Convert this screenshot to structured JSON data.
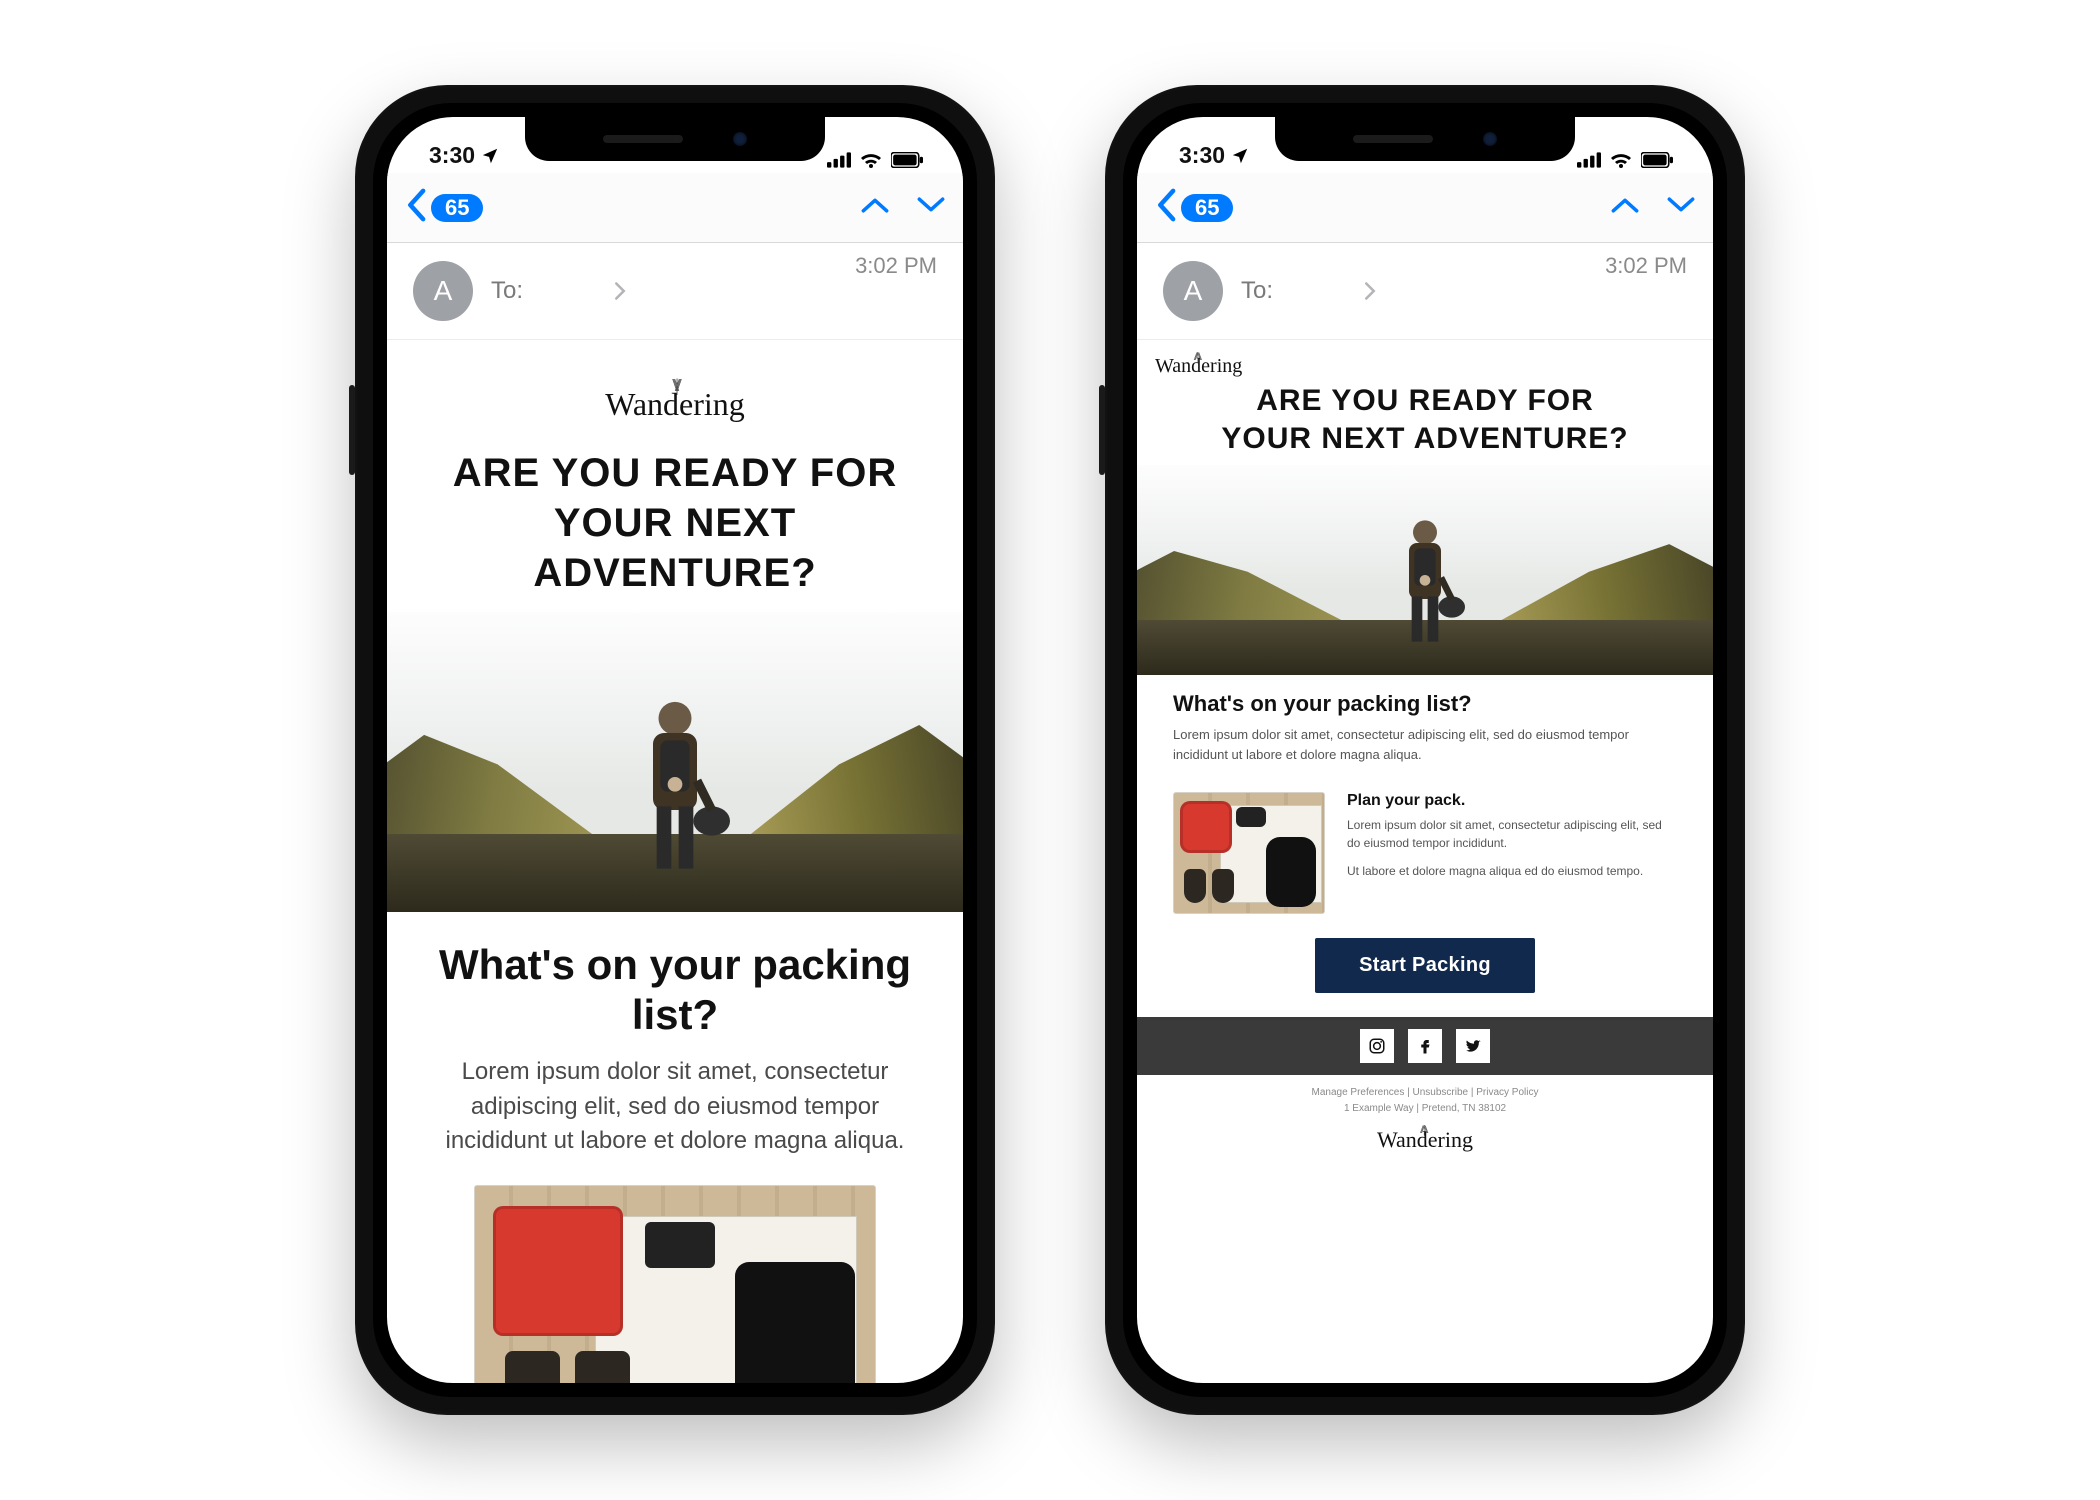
{
  "status": {
    "time": "3:30",
    "location_icon": "location-arrow"
  },
  "nav": {
    "back_badge": "65"
  },
  "mail": {
    "avatar_initial": "A",
    "to_label": "To:",
    "timestamp": "3:02 PM"
  },
  "brand": {
    "name": "Wandering"
  },
  "headline_line1": "ARE YOU READY FOR",
  "headline_line2": "YOUR NEXT ADVENTURE?",
  "section": {
    "subhead": "What's on your packing list?",
    "body": "Lorem ipsum dolor sit amet, consectetur adipiscing elit, sed do eiusmod tempor incididunt ut labore et dolore magna aliqua."
  },
  "pack": {
    "title": "Plan your pack.",
    "body1": "Lorem ipsum dolor sit amet, consectetur adipiscing elit, sed do eiusmod tempor incididunt.",
    "body2": "Ut labore et dolore magna aliqua ed do eiusmod tempo."
  },
  "cta": {
    "label": "Start Packing"
  },
  "footer": {
    "links": {
      "manage": "Manage Preferences",
      "unsub": "Unsubscribe",
      "privacy": "Privacy Policy"
    },
    "sep": " | ",
    "address": "1 Example Way | Pretend, TN 38102"
  }
}
